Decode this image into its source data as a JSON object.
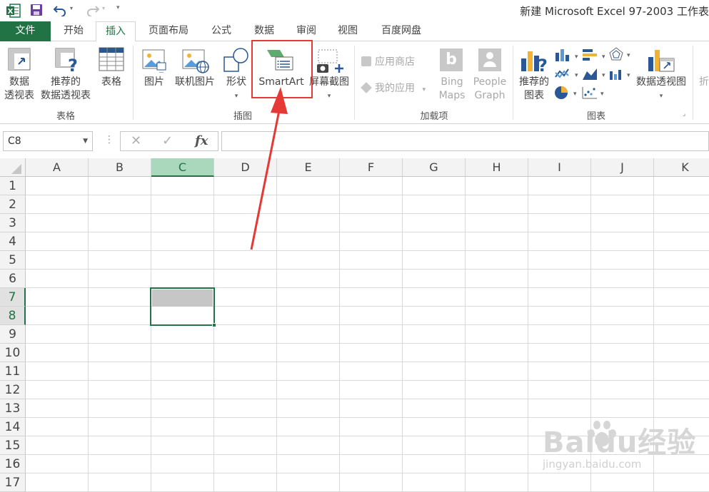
{
  "window": {
    "title": "新建 Microsoft Excel 97-2003 工作表"
  },
  "tabs": [
    {
      "label": "文件"
    },
    {
      "label": "开始"
    },
    {
      "label": "插入"
    },
    {
      "label": "页面布局"
    },
    {
      "label": "公式"
    },
    {
      "label": "数据"
    },
    {
      "label": "审阅"
    },
    {
      "label": "视图"
    },
    {
      "label": "百度网盘"
    }
  ],
  "ribbon": {
    "tables": {
      "pivot_line1": "数据",
      "pivot_line2": "透视表",
      "rec_pivot_line1": "推荐的",
      "rec_pivot_line2": "数据透视表",
      "table": "表格",
      "group": "表格"
    },
    "illustrations": {
      "pictures": "图片",
      "online_pictures": "联机图片",
      "shapes": "形状",
      "smartart": "SmartArt",
      "screenshot": "屏幕截图",
      "group": "插图"
    },
    "addins": {
      "store": "应用商店",
      "my_apps": "我的应用",
      "bing_line1": "Bing",
      "bing_line2": "Maps",
      "people_line1": "People",
      "people_line2": "Graph",
      "group": "加载项"
    },
    "charts": {
      "rec_line1": "推荐的",
      "rec_line2": "图表",
      "pivot_chart": "数据透视图",
      "group": "图表",
      "partial": "折"
    }
  },
  "formula_bar": {
    "name_box": "C8",
    "cancel": "✕",
    "enter": "✓",
    "fx": "fx",
    "value": ""
  },
  "sheet": {
    "columns": [
      "A",
      "B",
      "C",
      "D",
      "E",
      "F",
      "G",
      "H",
      "I",
      "J",
      "K"
    ],
    "rows": [
      "1",
      "2",
      "3",
      "4",
      "5",
      "6",
      "7",
      "8",
      "9",
      "10",
      "11",
      "12",
      "13",
      "14",
      "15",
      "16",
      "17"
    ],
    "selected_column": "C",
    "selected_rows": [
      "7",
      "8"
    ]
  },
  "watermark": {
    "brand": "Baidu经验",
    "url": "jingyan.baidu.com"
  },
  "colors": {
    "excel_green": "#217346",
    "highlight_red": "#e53935"
  }
}
